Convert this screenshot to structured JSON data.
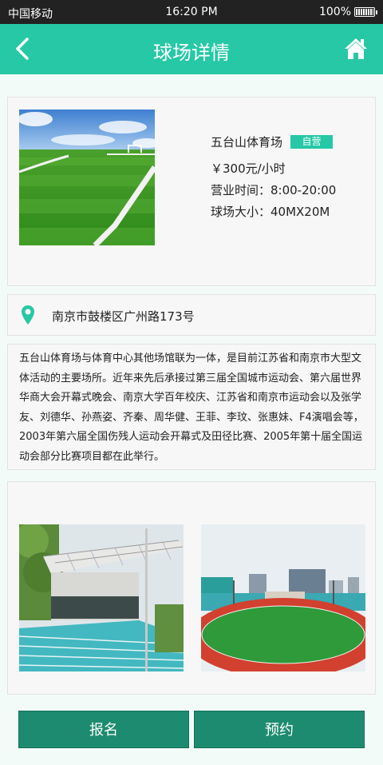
{
  "status_bar": {
    "carrier": "中国移动",
    "time": "16:20 PM",
    "battery": "100%"
  },
  "nav": {
    "title": "球场详情",
    "back_icon": "chevron-left-icon",
    "home_icon": "home-icon"
  },
  "venue": {
    "name": "五台山体育场",
    "badge": "自营",
    "price": "￥300元/小时",
    "hours": "营业时间：8:00-20:00",
    "size": "球场大小：40MX20M"
  },
  "address": {
    "text": "南京市鼓楼区广州路173号",
    "icon": "location-pin-icon"
  },
  "description": "五台山体育场与体育中心其他场馆联为一体，是目前江苏省和南京市大型文体活动的主要场所。近年来先后承接过第三届全国城市运动会、第六届世界华商大会开幕式晚会、南京大学百年校庆、江苏省和南京市运动会以及张学友、刘德华、孙燕姿、齐秦、周华健、王菲、李玟、张惠妹、F4演唱会等，2003年第六届全国伤残人运动会开幕式及田径比赛、2005年第十届全国运动会部分比赛项目都在此举行。",
  "actions": {
    "signup": "报名",
    "reserve": "预约"
  },
  "colors": {
    "accent": "#26c8a6",
    "button": "#1d8b6f"
  }
}
